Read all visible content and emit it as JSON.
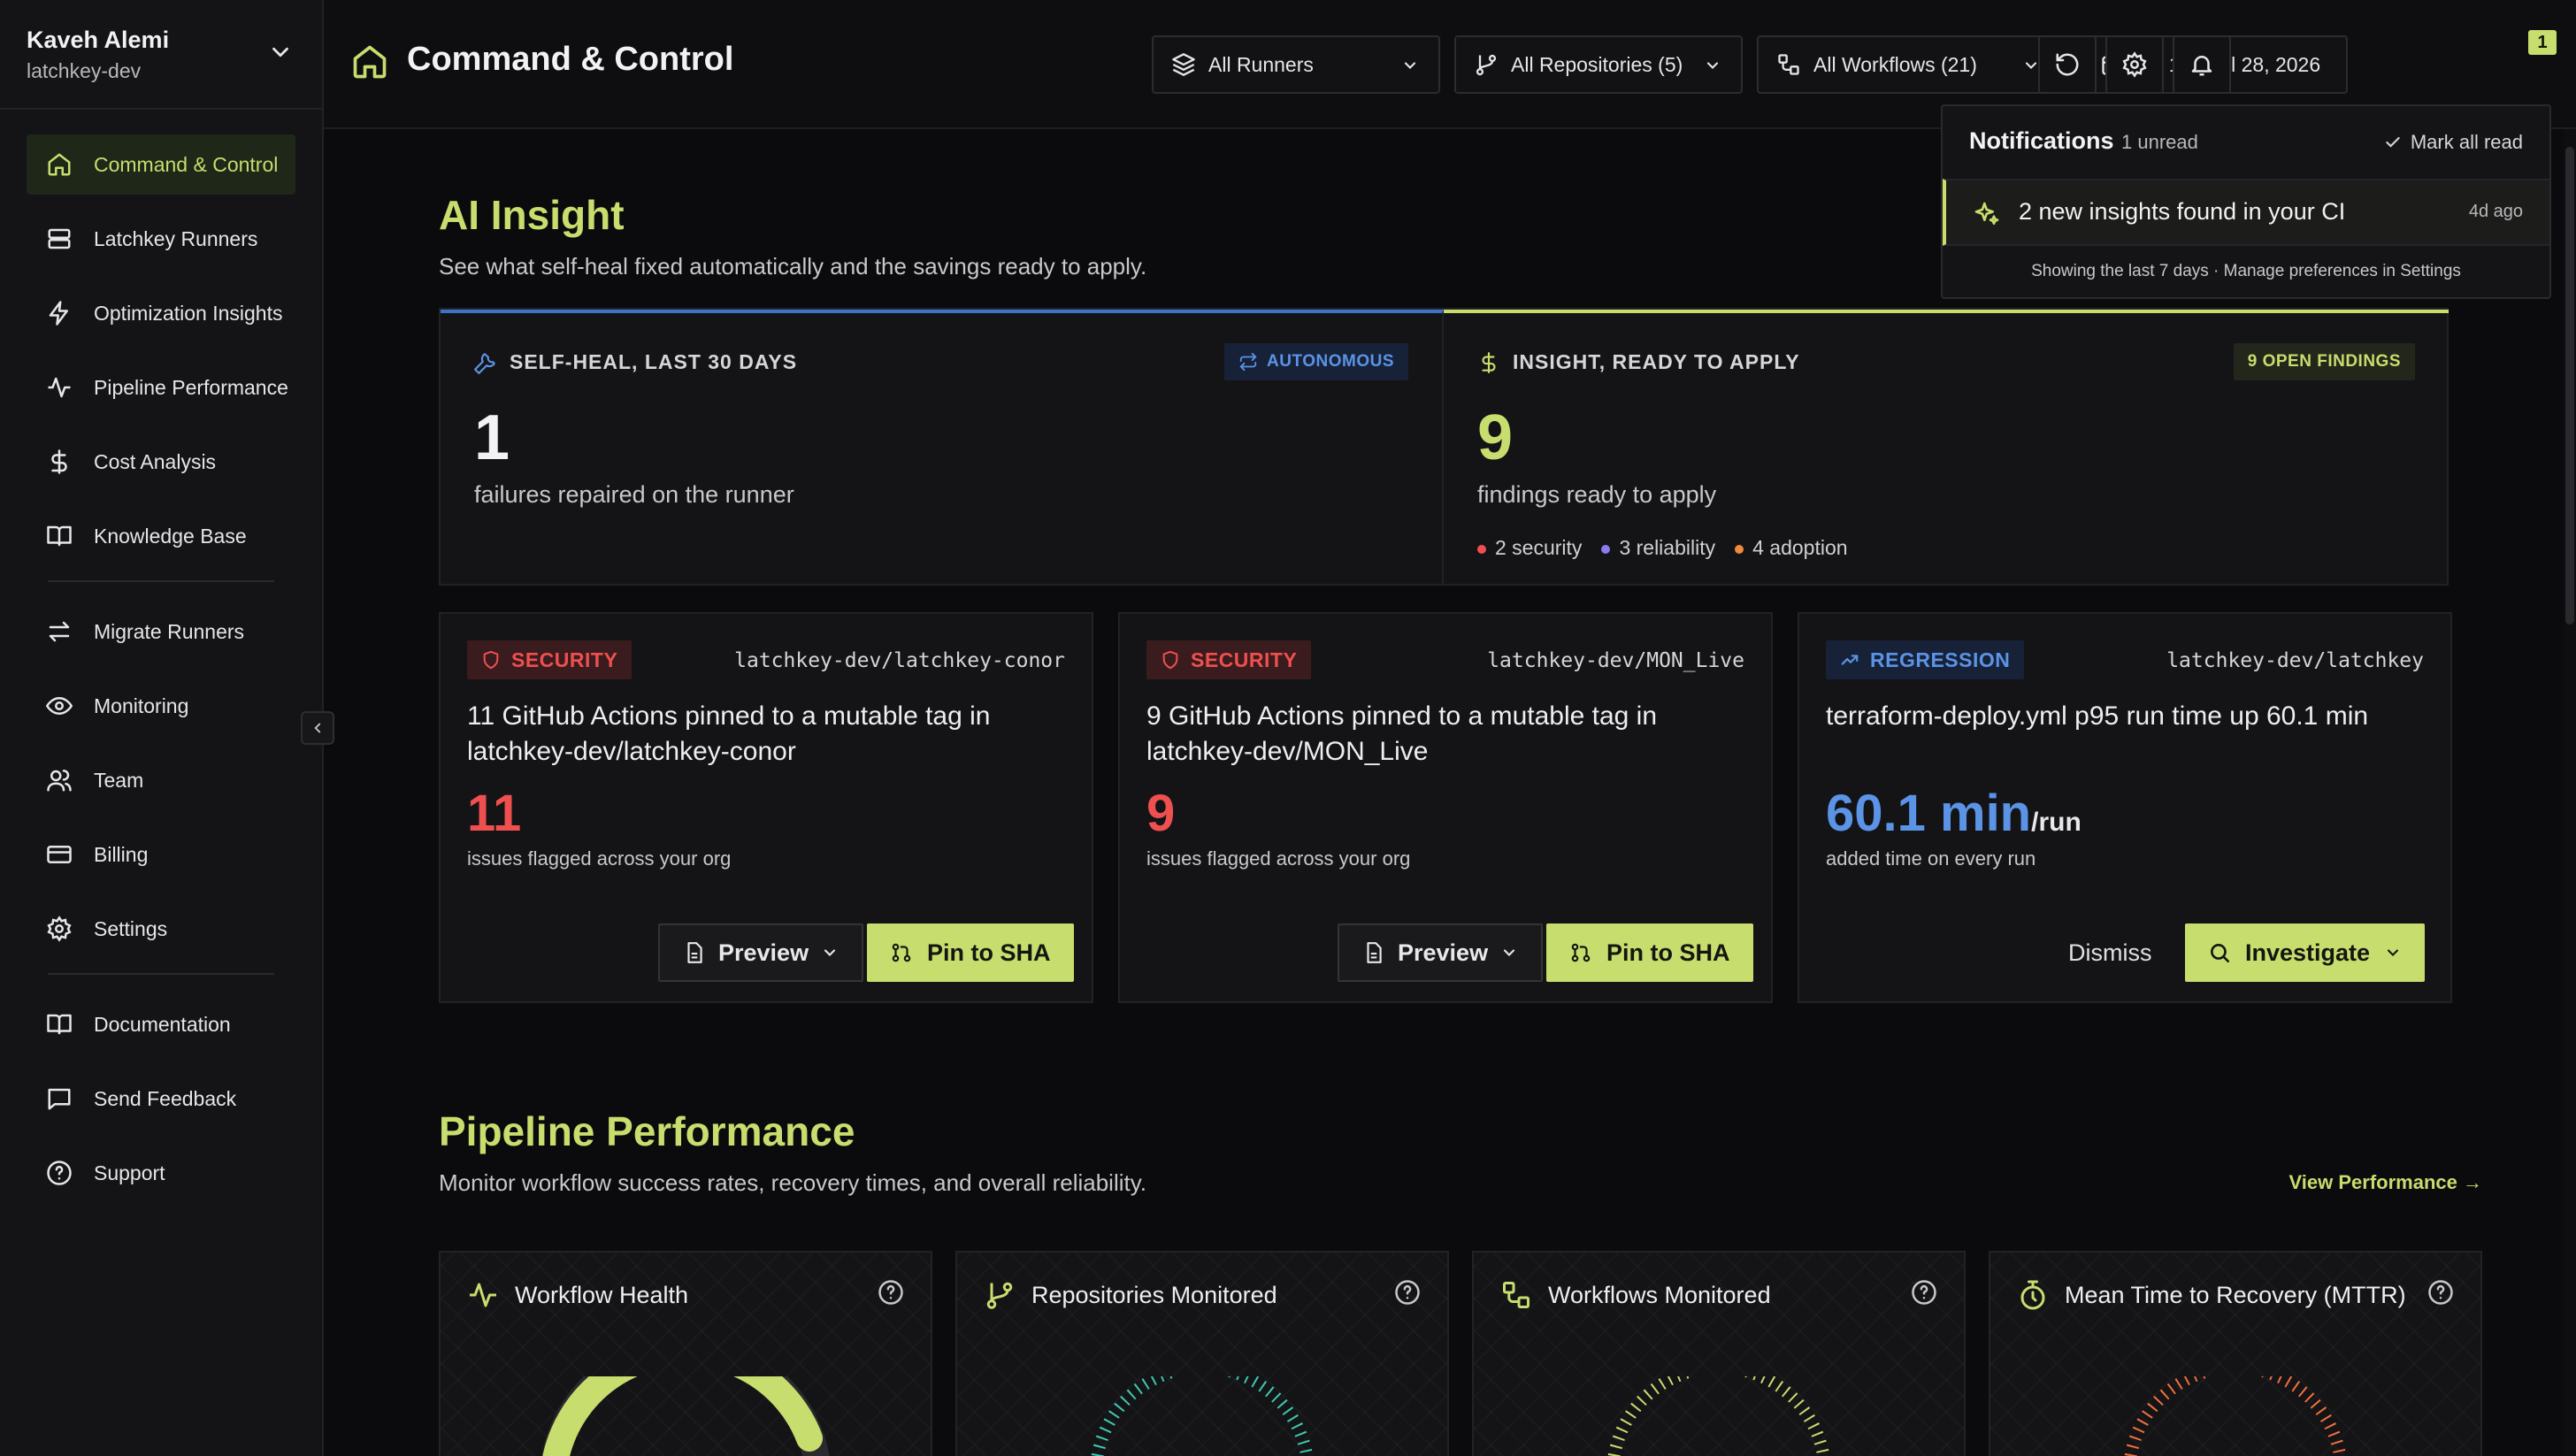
{
  "account": {
    "name": "Kaveh Alemi",
    "org": "latchkey-dev"
  },
  "nav": {
    "items": [
      {
        "label": "Command & Control",
        "icon": "home-icon",
        "active": true
      },
      {
        "label": "Latchkey Runners",
        "icon": "server-icon"
      },
      {
        "label": "Optimization Insights",
        "icon": "bolt-icon"
      },
      {
        "label": "Pipeline Performance",
        "icon": "activity-icon"
      },
      {
        "label": "Cost Analysis",
        "icon": "dollar-icon"
      },
      {
        "label": "Knowledge Base",
        "icon": "book-icon"
      },
      {
        "label": "Migrate Runners",
        "icon": "arrows-swap-icon"
      },
      {
        "label": "Monitoring",
        "icon": "eye-icon"
      },
      {
        "label": "Team",
        "icon": "users-icon"
      },
      {
        "label": "Billing",
        "icon": "credit-card-icon"
      },
      {
        "label": "Settings",
        "icon": "gear-icon"
      },
      {
        "label": "Documentation",
        "icon": "book-open-icon"
      },
      {
        "label": "Send Feedback",
        "icon": "message-icon"
      },
      {
        "label": "Support",
        "icon": "help-circle-icon"
      }
    ]
  },
  "header": {
    "title": "Command & Control",
    "filters": {
      "runners": "All Runners",
      "repositories": "All Repositories (5)",
      "workflows": "All Workflows (21)",
      "date_range": "Jul 14 - Jul 28, 2026"
    },
    "notification_count": "1"
  },
  "notifications": {
    "title": "Notifications",
    "unread": "1 unread",
    "mark_all": "Mark all read",
    "item": {
      "text": "2 new insights found in your CI",
      "time": "4d ago"
    },
    "footer": "Showing the last 7 days · Manage preferences in Settings"
  },
  "ai_insight": {
    "title": "AI Insight",
    "subtitle": "See what self-heal fixed automatically and the savings ready to apply.",
    "self_heal": {
      "caption": "SELF-HEAL, LAST 30 DAYS",
      "tag": "AUTONOMOUS",
      "value": "1",
      "label": "failures repaired on the runner"
    },
    "ready": {
      "caption": "INSIGHT, READY TO APPLY",
      "tag": "9 OPEN FINDINGS",
      "value": "9",
      "label": "findings ready to apply",
      "breakdown": [
        {
          "label": "2 security",
          "color": "#ef4f4f"
        },
        {
          "label": "3 reliability",
          "color": "#8a7cf0"
        },
        {
          "label": "4 adoption",
          "color": "#f08a3c"
        }
      ]
    },
    "cards": [
      {
        "tag": "SECURITY",
        "repo": "latchkey-dev/latchkey-conor",
        "title": "11 GitHub Actions pinned to a mutable tag in latchkey-dev/latchkey-conor",
        "value": "11",
        "unit": "",
        "sub": "issues flagged across your org",
        "secondary": "Preview",
        "primary": "Pin to SHA"
      },
      {
        "tag": "SECURITY",
        "repo": "latchkey-dev/MON_Live",
        "title": "9 GitHub Actions pinned to a mutable tag in latchkey-dev/MON_Live",
        "value": "9",
        "unit": "",
        "sub": "issues flagged across your org",
        "secondary": "Preview",
        "primary": "Pin to SHA"
      },
      {
        "tag": "REGRESSION",
        "repo": "latchkey-dev/latchkey",
        "title": "terraform-deploy.yml p95 run time up 60.1 min",
        "value": "60.1 min",
        "unit": "/run",
        "sub": "added time on every run",
        "secondary": "Dismiss",
        "primary": "Investigate"
      }
    ]
  },
  "pipeline": {
    "title": "Pipeline Performance",
    "subtitle": "Monitor workflow success rates, recovery times, and overall reliability.",
    "link": "View Performance →",
    "metrics": [
      {
        "label": "Workflow Health"
      },
      {
        "label": "Repositories Monitored"
      },
      {
        "label": "Workflows Monitored"
      },
      {
        "label": "Mean Time to Recovery (MTTR)"
      }
    ]
  },
  "colors": {
    "accent": "#c7dd6d",
    "security": "#ef4f4f",
    "regression": "#5b93e6",
    "background": "#0b0b0d"
  }
}
